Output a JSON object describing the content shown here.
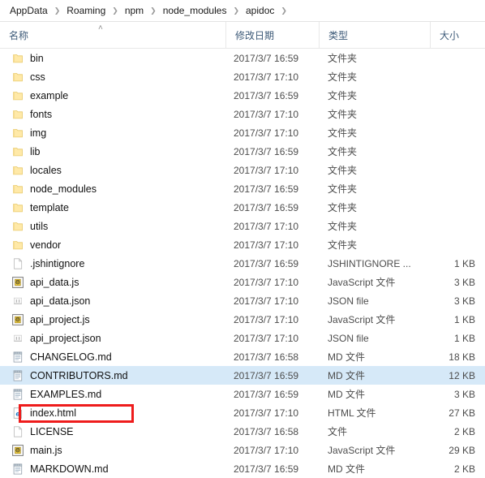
{
  "breadcrumb": {
    "separator": "❯",
    "items": [
      {
        "label": "AppData"
      },
      {
        "label": "Roaming"
      },
      {
        "label": "npm"
      },
      {
        "label": "node_modules"
      },
      {
        "label": "apidoc"
      }
    ]
  },
  "columns": {
    "name": "名称",
    "date": "修改日期",
    "type": "类型",
    "size": "大小",
    "sort_indicator": "˄"
  },
  "colors": {
    "selection": "#d6e9f8",
    "annotation": "#ee1c1c",
    "header_text": "#3d5a78",
    "folder": "#ffe9a8"
  },
  "annotation": {
    "target": "index.html",
    "shape": "rectangle",
    "color": "#ee1c1c"
  },
  "files": [
    {
      "name": "bin",
      "icon": "folder-icon",
      "date": "2017/3/7 16:59",
      "type": "文件夹",
      "size": "",
      "selected": false
    },
    {
      "name": "css",
      "icon": "folder-icon",
      "date": "2017/3/7 17:10",
      "type": "文件夹",
      "size": "",
      "selected": false
    },
    {
      "name": "example",
      "icon": "folder-icon",
      "date": "2017/3/7 16:59",
      "type": "文件夹",
      "size": "",
      "selected": false
    },
    {
      "name": "fonts",
      "icon": "folder-icon",
      "date": "2017/3/7 17:10",
      "type": "文件夹",
      "size": "",
      "selected": false
    },
    {
      "name": "img",
      "icon": "folder-icon",
      "date": "2017/3/7 17:10",
      "type": "文件夹",
      "size": "",
      "selected": false
    },
    {
      "name": "lib",
      "icon": "folder-icon",
      "date": "2017/3/7 16:59",
      "type": "文件夹",
      "size": "",
      "selected": false
    },
    {
      "name": "locales",
      "icon": "folder-icon",
      "date": "2017/3/7 17:10",
      "type": "文件夹",
      "size": "",
      "selected": false
    },
    {
      "name": "node_modules",
      "icon": "folder-icon",
      "date": "2017/3/7 16:59",
      "type": "文件夹",
      "size": "",
      "selected": false
    },
    {
      "name": "template",
      "icon": "folder-icon",
      "date": "2017/3/7 16:59",
      "type": "文件夹",
      "size": "",
      "selected": false
    },
    {
      "name": "utils",
      "icon": "folder-icon",
      "date": "2017/3/7 17:10",
      "type": "文件夹",
      "size": "",
      "selected": false
    },
    {
      "name": "vendor",
      "icon": "folder-icon",
      "date": "2017/3/7 17:10",
      "type": "文件夹",
      "size": "",
      "selected": false
    },
    {
      "name": ".jshintignore",
      "icon": "blank-file-icon",
      "date": "2017/3/7 16:59",
      "type": "JSHINTIGNORE ...",
      "size": "1 KB",
      "selected": false
    },
    {
      "name": "api_data.js",
      "icon": "js-file-icon",
      "date": "2017/3/7 17:10",
      "type": "JavaScript 文件",
      "size": "3 KB",
      "selected": false
    },
    {
      "name": "api_data.json",
      "icon": "json-file-icon",
      "date": "2017/3/7 17:10",
      "type": "JSON file",
      "size": "3 KB",
      "selected": false
    },
    {
      "name": "api_project.js",
      "icon": "js-file-icon",
      "date": "2017/3/7 17:10",
      "type": "JavaScript 文件",
      "size": "1 KB",
      "selected": false
    },
    {
      "name": "api_project.json",
      "icon": "json-file-icon",
      "date": "2017/3/7 17:10",
      "type": "JSON file",
      "size": "1 KB",
      "selected": false
    },
    {
      "name": "CHANGELOG.md",
      "icon": "md-file-icon",
      "date": "2017/3/7 16:58",
      "type": "MD 文件",
      "size": "18 KB",
      "selected": false
    },
    {
      "name": "CONTRIBUTORS.md",
      "icon": "md-file-icon",
      "date": "2017/3/7 16:59",
      "type": "MD 文件",
      "size": "12 KB",
      "selected": true
    },
    {
      "name": "EXAMPLES.md",
      "icon": "md-file-icon",
      "date": "2017/3/7 16:59",
      "type": "MD 文件",
      "size": "3 KB",
      "selected": false
    },
    {
      "name": "index.html",
      "icon": "html-file-icon",
      "date": "2017/3/7 17:10",
      "type": "HTML 文件",
      "size": "27 KB",
      "selected": false
    },
    {
      "name": "LICENSE",
      "icon": "blank-file-icon",
      "date": "2017/3/7 16:58",
      "type": "文件",
      "size": "2 KB",
      "selected": false
    },
    {
      "name": "main.js",
      "icon": "js-file-icon",
      "date": "2017/3/7 17:10",
      "type": "JavaScript 文件",
      "size": "29 KB",
      "selected": false
    },
    {
      "name": "MARKDOWN.md",
      "icon": "md-file-icon",
      "date": "2017/3/7 16:59",
      "type": "MD 文件",
      "size": "2 KB",
      "selected": false
    }
  ]
}
